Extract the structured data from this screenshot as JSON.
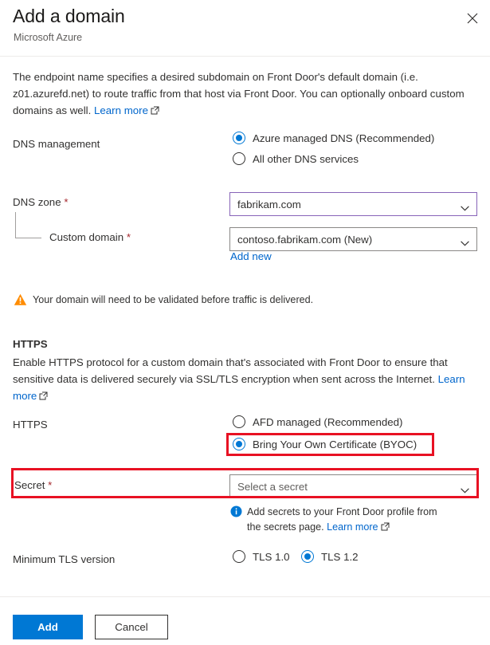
{
  "header": {
    "title": "Add a domain",
    "subtitle": "Microsoft Azure",
    "close_icon": "close-icon"
  },
  "intro": {
    "text": "The endpoint name specifies a desired subdomain on Front Door's default domain (i.e. z01.azurefd.net) to route traffic from that host via Front Door. You can optionally onboard custom domains as well. ",
    "link_label": "Learn more"
  },
  "dns_management": {
    "label": "DNS management",
    "options": [
      {
        "label": "Azure managed DNS (Recommended)",
        "selected": true
      },
      {
        "label": "All other DNS services",
        "selected": false
      }
    ]
  },
  "dns_zone": {
    "label": "DNS zone",
    "required_marker": "*",
    "value": "fabrikam.com",
    "focused": true
  },
  "custom_domain": {
    "label": "Custom domain",
    "required_marker": "*",
    "value": "contoso.fabrikam.com (New)",
    "add_new_label": "Add new"
  },
  "warning": {
    "icon": "warning-icon",
    "text": "Your domain will need to be validated before traffic is delivered."
  },
  "https_section": {
    "heading": "HTTPS",
    "description": "Enable HTTPS protocol for a custom domain that's associated with Front Door to ensure that sensitive data is delivered securely via SSL/TLS encryption when sent across the Internet. ",
    "link_label": "Learn more"
  },
  "https_field": {
    "label": "HTTPS",
    "options": [
      {
        "label": "AFD managed (Recommended)",
        "selected": false
      },
      {
        "label": "Bring Your Own Certificate (BYOC)",
        "selected": true
      }
    ]
  },
  "secret": {
    "label": "Secret",
    "required_marker": "*",
    "placeholder": "Select a secret",
    "note_icon": "info-icon",
    "note_line1": "Add secrets to your Front Door profile from",
    "note_line2": "the secrets page. ",
    "note_link_label": "Learn more"
  },
  "tls": {
    "label": "Minimum TLS version",
    "options": [
      {
        "label": "TLS 1.0",
        "selected": false
      },
      {
        "label": "TLS 1.2",
        "selected": true
      }
    ]
  },
  "footer": {
    "add_label": "Add",
    "cancel_label": "Cancel"
  },
  "colors": {
    "accent": "#0078d4",
    "focus_border": "#8764b8",
    "required": "#a4262c",
    "highlight": "#e81123",
    "warning": "#ff8c00",
    "link": "#0066cc"
  }
}
